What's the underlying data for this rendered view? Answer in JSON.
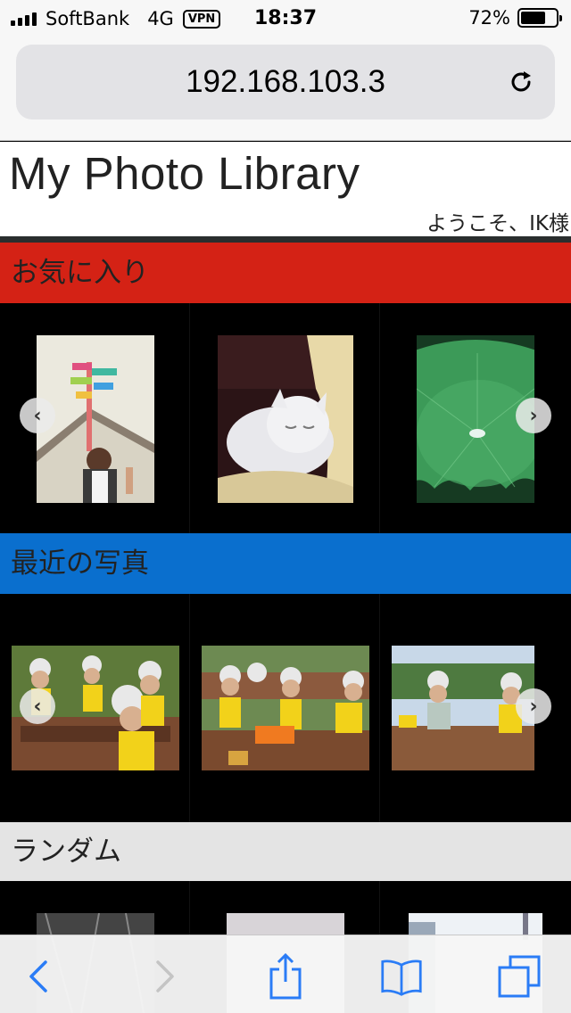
{
  "status_bar": {
    "carrier": "SoftBank",
    "network": "4G",
    "vpn": "VPN",
    "time": "18:37",
    "battery_percent": "72%",
    "battery_level": 0.72
  },
  "browser": {
    "url": "192.168.103.3",
    "accent_color": "#2a7cf6"
  },
  "site": {
    "title": "My Photo Library",
    "welcome": "ようこそ、IK様"
  },
  "sections": {
    "favorites": {
      "label": "お気に入り",
      "color": "#d42215"
    },
    "recent": {
      "label": "最近の写真",
      "color": "#0a6fce"
    },
    "random": {
      "label": "ランダム",
      "color": "#e4e4e4"
    }
  },
  "photos": {
    "favorites": [
      "pinwheel-child-photo",
      "sleeping-white-kitten-photo",
      "lotus-leaf-photo"
    ],
    "recent": [
      "rafting-group-photo-1",
      "rafting-group-photo-2",
      "rafting-group-photo-3"
    ],
    "random": [
      "monochrome-photo",
      "building-photo",
      "tower-photo"
    ]
  },
  "icons": {
    "prev": "chevron-left-icon",
    "next": "chevron-right-icon",
    "reload": "reload-icon",
    "back": "back-icon",
    "forward": "forward-icon",
    "share": "share-icon",
    "bookmarks": "bookmarks-icon",
    "tabs": "tabs-icon"
  }
}
